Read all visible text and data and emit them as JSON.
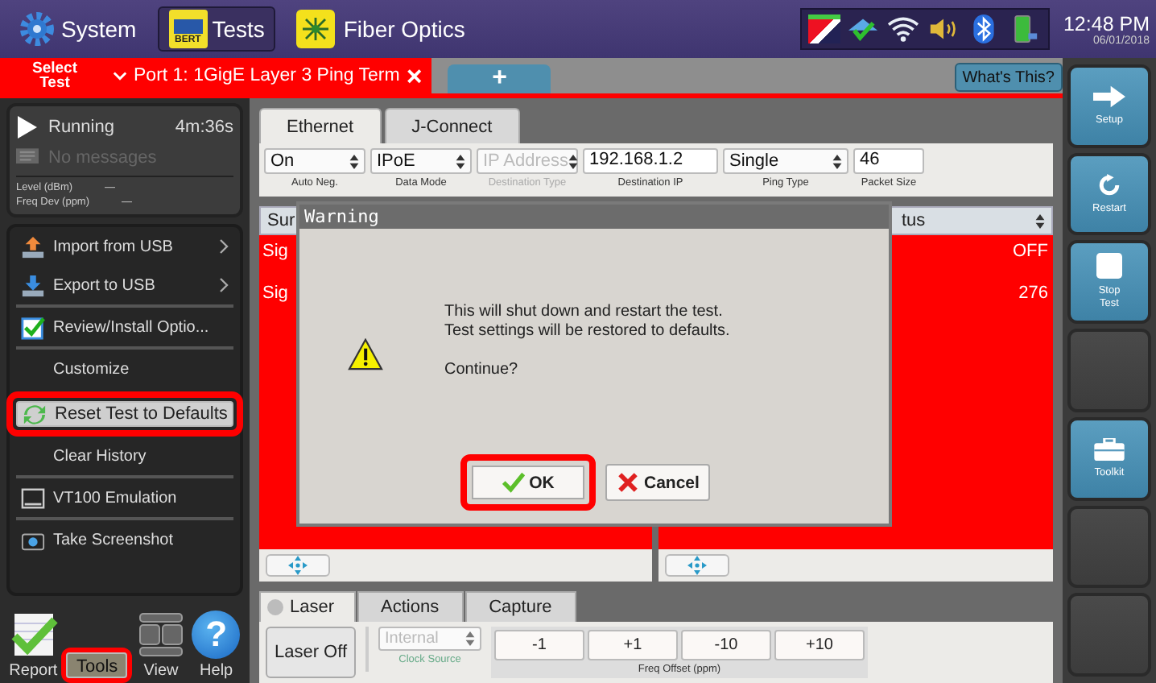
{
  "top_bar": {
    "apps": [
      {
        "label": "System",
        "kind": "gear",
        "selected": false
      },
      {
        "label": "Tests",
        "kind": "bert",
        "icon_text": "BERT",
        "selected": true
      },
      {
        "label": "Fiber Optics",
        "kind": "fiber",
        "selected": false
      }
    ],
    "time": "12:48 PM",
    "date": "06/01/2018"
  },
  "test_tabs": {
    "select_label": "Select Test",
    "tabs": [
      {
        "label": "Port 1: 1GigE Layer 3 Ping Term",
        "close": "×"
      }
    ],
    "new_tab": "+",
    "help_button": "What's This?"
  },
  "status": {
    "state": "Running",
    "running": true,
    "elapsed": "4m:36s",
    "messages": "No messages",
    "readings": [
      {
        "label": "Level (dBm)",
        "value": "—"
      },
      {
        "label": "Freq Dev (ppm)",
        "value": "—"
      }
    ]
  },
  "tools_menu": [
    {
      "label": "Import from USB",
      "kind": "import",
      "submenu": true,
      "divider_after": false,
      "selected": false,
      "highlighted": false
    },
    {
      "label": "Export to USB",
      "kind": "export",
      "submenu": true,
      "divider_after": true,
      "selected": false,
      "highlighted": false
    },
    {
      "label": "Review/Install Optio...",
      "kind": "review",
      "submenu": false,
      "divider_after": true,
      "selected": false,
      "highlighted": false
    },
    {
      "label": "Customize",
      "kind": "plain",
      "submenu": false,
      "divider_after": false,
      "selected": false,
      "highlighted": false
    },
    {
      "label": "Reset Test to Defaults",
      "kind": "reset",
      "submenu": false,
      "divider_after": false,
      "selected": true,
      "highlighted": true
    },
    {
      "label": "Clear History",
      "kind": "plain",
      "submenu": false,
      "divider_after": true,
      "selected": false,
      "highlighted": false
    },
    {
      "label": "VT100 Emulation",
      "kind": "terminal",
      "submenu": false,
      "divider_after": true,
      "selected": false,
      "highlighted": false
    },
    {
      "label": "Take Screenshot",
      "kind": "camera",
      "submenu": false,
      "divider_after": false,
      "selected": false,
      "highlighted": false
    }
  ],
  "bottom_nav": [
    {
      "label": "Report",
      "kind": "report",
      "selected": false,
      "highlighted": false
    },
    {
      "label": "Tools",
      "kind": "tools",
      "selected": true,
      "highlighted": true
    },
    {
      "label": "View",
      "kind": "view",
      "selected": false,
      "highlighted": false
    },
    {
      "label": "Help",
      "kind": "help",
      "icon_text": "?",
      "selected": false,
      "highlighted": false
    }
  ],
  "config_tabs": [
    {
      "label": "Ethernet",
      "selected": true
    },
    {
      "label": "J-Connect",
      "selected": false
    }
  ],
  "fields": [
    {
      "kind": "select",
      "value": "On",
      "caption": "Auto Neg.",
      "disabled": false
    },
    {
      "kind": "select",
      "value": "IPoE",
      "caption": "Data Mode",
      "disabled": false
    },
    {
      "kind": "select",
      "value": "IP Address",
      "caption": "Destination Type",
      "disabled": true
    },
    {
      "kind": "input",
      "value": "192.168.1.2",
      "caption": "Destination IP",
      "disabled": false
    },
    {
      "kind": "select",
      "value": "Single",
      "caption": "Ping Type",
      "disabled": false
    },
    {
      "kind": "input",
      "value": "46",
      "caption": "Packet Size",
      "disabled": false
    }
  ],
  "results": [
    {
      "header": "Sur",
      "alarm": true,
      "rows": [
        "Sig",
        "Sig"
      ]
    },
    {
      "header": "tus",
      "alarm": true,
      "rows": [
        "OFF",
        "276"
      ]
    }
  ],
  "laser_tabs": [
    {
      "label": "Laser",
      "indicator": true,
      "laser_on": false,
      "selected": true
    },
    {
      "label": "Actions",
      "indicator": false,
      "selected": false
    },
    {
      "label": "Capture",
      "indicator": false,
      "selected": false
    }
  ],
  "laser_controls": {
    "laser_button": "Laser Off",
    "clock": {
      "value": "Internal",
      "caption": "Clock Source",
      "disabled": true
    },
    "offset_buttons": [
      "-1",
      "+1",
      "-10",
      "+10"
    ],
    "offset_caption": "Freq Offset (ppm)"
  },
  "side_buttons": [
    {
      "kind": "setup",
      "label": "Setup"
    },
    {
      "kind": "restart",
      "label": "Restart"
    },
    {
      "kind": "stop",
      "label": "Stop Test"
    },
    {
      "kind": "blank"
    },
    {
      "kind": "toolkit",
      "label": "Toolkit"
    },
    {
      "kind": "blank"
    },
    {
      "kind": "blank"
    }
  ],
  "dialog": {
    "title": "Warning",
    "lines": [
      "This will shut down and restart the test.",
      "Test settings will be restored to defaults."
    ],
    "question": "Continue?",
    "buttons": [
      {
        "kind": "ok",
        "label": "OK",
        "highlighted": true
      },
      {
        "kind": "cancel",
        "label": "Cancel",
        "highlighted": false
      }
    ]
  }
}
